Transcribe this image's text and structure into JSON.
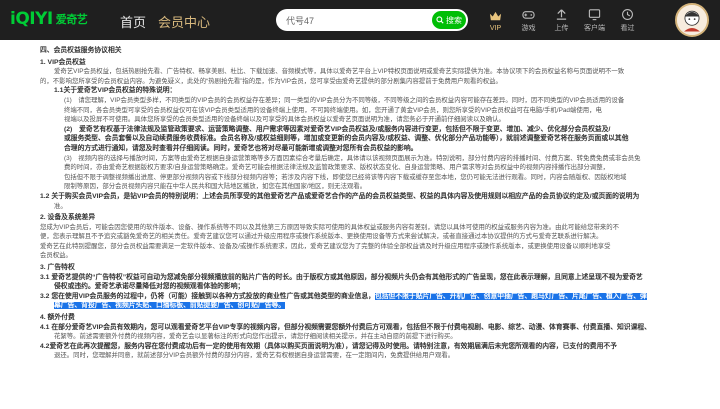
{
  "header": {
    "logo_text": "iQIYI",
    "logo_cn": "爱奇艺",
    "nav_home": "首页",
    "nav_member": "会员中心",
    "search_value": "代号47",
    "search_button": "搜索",
    "tools": [
      {
        "icon": "vip-crown-icon",
        "label": "VIP"
      },
      {
        "icon": "gamepad-icon",
        "label": "游戏"
      },
      {
        "icon": "upload-icon",
        "label": "上传"
      },
      {
        "icon": "client-icon",
        "label": "客户端"
      },
      {
        "icon": "history-icon",
        "label": "看过"
      }
    ],
    "colors": {
      "bar": "#1f1f1f",
      "brand": "#00cc36",
      "search_btn": "#00be06",
      "member": "#d8b97e"
    }
  },
  "doc": {
    "l01": "四、会员权益服务协议相关",
    "l02": "1. VIP会员权益",
    "l03": "爱奇艺VIP会员权益，包括热剧抢先看、广告特权、畅享美剧、杜比、下载加速、音频模式等，具体以爱奇艺平台上VIP特权页面说明或爱奇艺实际提供为准。本协议项下的会员权益名称与页面说明不一致",
    "l04": "的，不影响您所享受的会员权益内容。为避免疑义，此处的“热剧抢先看”指的是，作为VIP会员，您可享受由爱奇艺提供的部分剧集内容提前于免费用户观看的权益。",
    "l05": "1.1关于爱奇艺VIP会员权益的特殊说明：",
    "l06": "(1)　请您理解，VIP会员类型多样，不同类型的VIP会员的会员权益存在差异；同一类型的VIP会员分为不同等级，不同等级之间的会员权益内容可能存在差异。同时，因不同类型的VIP会员适用的设备",
    "l07": "终端不同，各会员类型可享受的会员权益仅可在该VIP会员类型适用的设备终端上使用，不可跨终端使用。如，您开通了黄金VIP会员，则您所享受的VIP会员权益可在电脑/手机/Pad端使用，电",
    "l08": "视端以及投屏不可使用。具体您所享受的会员类型适用的设备终端以及可享受的具体会员权益以爱奇艺页面说明为准，请您务必于开通前仔细阅读以及确认。",
    "l09": "(2)　爱奇艺有权基于法律法规及监管政策要求、运营策略调整、用户需求等因素对爱奇艺VIP会员权益及/或服务内容进行变更，包括但不限于变更、增加、减少、优化部分会员权益及/",
    "l10": "或服务类型、会员套餐以及自动续费服务收费标准。会员名称及/或权益细则等，增加或变更新的会员内容及/或权益、调整、优化部分产品功能等），就前述调整爱奇艺将在服务页面或以其他",
    "l11": "合理的方式进行通知，请您及时查看并仔细阅读。同时，爱奇艺也将对尽最可能新增或调整对您所有会员权益的影响。",
    "l12": "(3)　视频内容的选择与播放时间，方案等由爱奇艺根据自身运营策略等多方面因素综合考量后确定，具体请以该视频页面展示为准。特别说明，部分付费内容的排播时间、付费方案、转免费免费或非会员免",
    "l13": "费的时间，亦由爱奇艺根据版权方要求/自身运营策略确定。爱奇艺可能会根据法律法规及监管政策要求、版权状态变化、自身运营策略、用户需求等对会员权益中的视频内容排播作出部分调整，",
    "l14": "包括但不限于调整视频播出进度、停更部分视频内容或下线部分视频内容等；若涉及内容下线，即使您已经将该等内容下载或缓存至您本地，您仍可能无法进行观看。同时，内容会随版权、因版权地域",
    "l15": "限制等原因，部分会员视频内容只能在中华人民共和国大陆地区播放，如您在其他国家/地区，则无法观看。",
    "l16": "1.2 关于购买会员VIP会员，是钻VIP会员的特别说明：上述会员所享受的其他爱奇艺产品或爱奇艺合作的产品的会员权益类型、权益的具体内容及使用规则以相应产品的会员协议约定及/或页面的说明为",
    "l17": "准。",
    "l18": "2. 设备及系统差异",
    "l19": "您成为VIP会员后，可能会因您使用的软件版本、设备、操作系统等不同以及其他第三方原因导致实际可使用的具体权益或服务内容有差别，请您以具体可使用的权益或服务内容为准。由此可能给您带来的不",
    "l20": "便，您表示理解且不予追究或豁免爱奇艺的相关责任。爱奇艺建议您可以通过升级应用程序或操作系统版本、更换使用设备等方式来尝试解决，或者直接通过本协议提供的方式与爱奇艺联系进行解决。",
    "l21": "爱奇艺在此特别提醒您，部分会员权益需要满足一定软件版本、设备及/或操作系统要求，因此，爱奇艺建议您为了完整的体验全部权益请及时升级应用程序或操作系统版本，或更换使用设备以顺利地享受",
    "l22": "会员权益。",
    "l23": "3. 广告特权",
    "l24": "3.1 爱奇艺提供的“广告特权”权益可自动为您减免部分视频播放前的贴片广告的时长。由于版权方或其他原因，部分视频片头仍会有其他形式的广告呈现，您在此表示理解，且同意上述呈现不视为爱奇艺",
    "l25": "侵权或违约。爱奇艺承诺尽量降低对您的视频观看体验的影响；",
    "l26a": "3.2 您在使用VIP会员服务的过程中，仍将（可能）接触到以各种方式投放的商业性广告或其他类型的商业信息，",
    "l26b": "包括但不限于贴片广告、开机广告、创意中插广告、跑马灯广告、片尾广告、植入广告、弹",
    "l27": "幕广告、背投广告、视频片头贴、口播标板、前贴提要广告、创可贴广告等。",
    "l28": "4. 额外付费",
    "l29": "4.1 在部分爱奇艺VIP会员有效期内，您可以观看爱奇艺平台VIP专享的视频内容，但部分视频需要您额外付费后方可观看，包括但不限于付费电视剧、电影、综艺、动漫、体育赛事、付费直播、知识课程、",
    "l30": "花絮等。前述需要额外付费的视频内容，爱奇艺会以显著标注的形式向您作出提示，请您仔细阅读相关提示，并在主动自愿的前提下进行购买。",
    "l31": "4.2爱奇艺在此再次提醒您，服务内容在您付费成功后有一定的使用有效期（具体以购买页面说明为准），请您记得及时使用。请特别注意，有效期届满后未完您所观看的内容，已支付的费用不予",
    "l32": "退还。同时，您理解并同意，就前述部分VIP会员额外付费的部分内容，爱奇艺有权根据自身运营需要，在一定期间内，免费提供给用户观看。"
  }
}
